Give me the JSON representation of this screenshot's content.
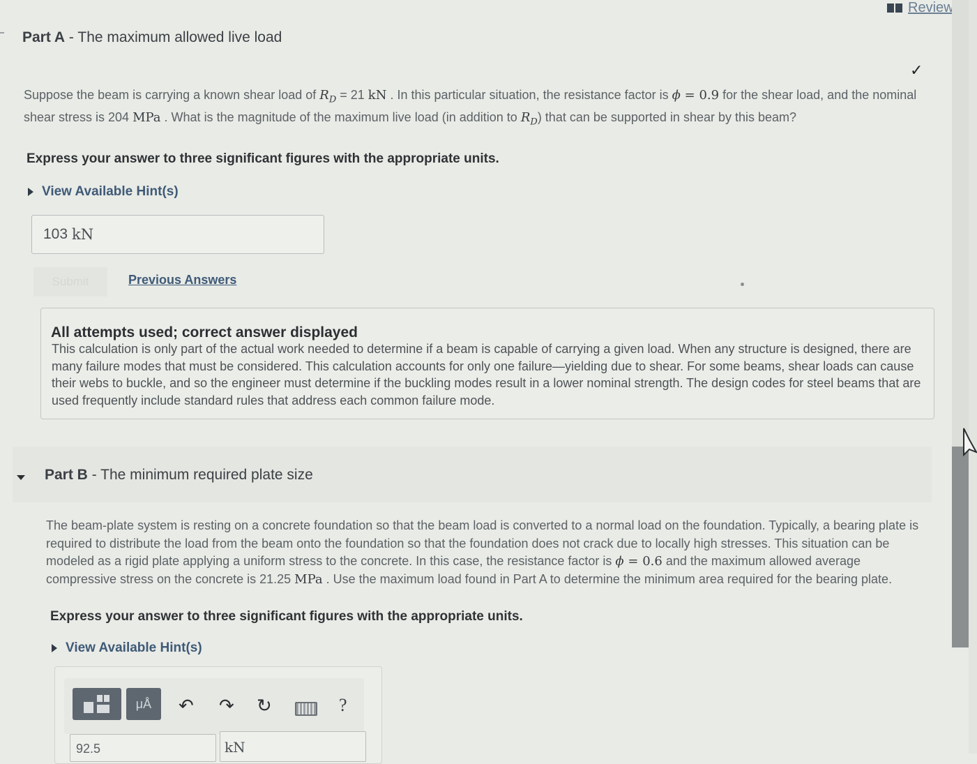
{
  "header": {
    "review_label": "Review"
  },
  "part_a": {
    "label": "Part A",
    "title": "- The maximum allowed live load",
    "question_parts": [
      "Suppose the beam is carrying a known shear load of ",
      "R",
      "D",
      " = 21 ",
      "kN",
      " . In this particular situation, the resistance factor is ",
      "ϕ",
      " = 0.9",
      " for the shear load, and the nominal shear stress is 204 ",
      "MPa",
      " . What is the magnitude of the maximum live load (in addition to ",
      "R",
      "D",
      ") that can be supported in shear by this beam?"
    ],
    "instruction": "Express your answer to three significant figures with the appropriate units.",
    "hint_label": "View Available Hint(s)",
    "answer_value": "103",
    "answer_unit": "kN",
    "submit_label": "Submit",
    "previous_answers_label": "Previous Answers",
    "feedback_title": "All attempts used; correct answer displayed",
    "feedback_body": "This calculation is only part of the actual work needed to determine if a beam is capable of carrying a given load. When any structure is designed, there are many failure modes that must be considered. This calculation accounts for only one failure—yielding due to shear. For some beams, shear loads can cause their webs to buckle, and so the engineer must determine if the buckling modes result in a lower nominal strength. The design codes for steel beams that are used frequently include standard rules that address each common failure mode."
  },
  "part_b": {
    "label": "Part B",
    "title": "- The minimum required plate size",
    "question_parts": [
      "The beam-plate system is resting on a concrete foundation so that the beam load is converted to a normal load on the foundation. Typically, a bearing plate is required to distribute the load from the beam onto the foundation so that the foundation does not crack due to locally high stresses. This situation can be modeled as a rigid plate applying a uniform stress to the concrete. In this case, the resistance factor is ",
      "ϕ",
      " = 0.6",
      " and the maximum allowed average compressive stress on the concrete is 21.25 ",
      "MPa",
      " . Use the maximum load found in Part A to determine the minimum area required for the bearing plate."
    ],
    "instruction": "Express your answer to three significant figures with the appropriate units.",
    "hint_label": "View Available Hint(s)",
    "toolbar": {
      "templates_icon": "templates-icon",
      "units_label": "μÅ",
      "undo_icon": "↶",
      "redo_icon": "↷",
      "reset_icon": "↻",
      "keyboard_icon": "keyboard-icon",
      "help_label": "?"
    },
    "value_input": "92.5",
    "unit_input": "kN"
  },
  "colors": {
    "link": "#3f5a78",
    "background": "#e9ebe6",
    "toolbar_button": "#5e6770"
  }
}
